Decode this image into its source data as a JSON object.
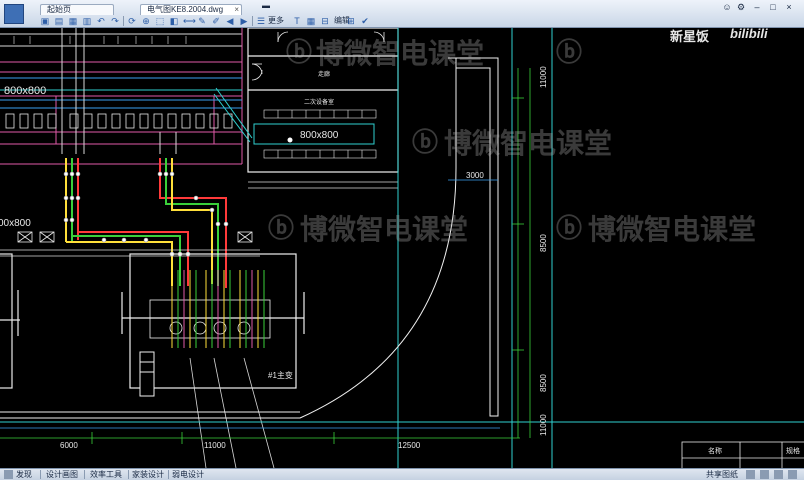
{
  "app": {
    "tabs": [
      {
        "label": "起始页"
      },
      {
        "label": "电气图KE8.2004.dwg"
      }
    ],
    "toolbar": {
      "more_label": "更多",
      "edit_label": "编辑"
    },
    "window": {
      "login_icon": "user-icon",
      "settings_icon": "gear-icon",
      "minimize": "–",
      "maximize": "□",
      "close": "×"
    }
  },
  "watermark": {
    "brand_text": "新星饭",
    "logo_text": "bilibili",
    "text": "博微智电课堂"
  },
  "drawing": {
    "labels": {
      "size_top_left": "800x800",
      "size_mid": "800x800",
      "size_left_bottom": "00x800",
      "corridor": "走廊",
      "room": "二次设备室",
      "transformer": "#1主变",
      "dim_3000": "3000",
      "dim_6000": "6000",
      "dim_11000": "11000",
      "dim_12500": "12500",
      "dim_r11000": "11000",
      "dim_r8500a": "8500",
      "dim_r8500b": "8500",
      "dim_r11000b": "11000",
      "table_col1": "名称",
      "table_col2": "规格"
    }
  },
  "bottom": {
    "tabs": [
      {
        "label": "发现"
      },
      {
        "label": "设计画图"
      },
      {
        "label": "效率工具"
      },
      {
        "label": "家装设计"
      },
      {
        "label": "弱电设计"
      }
    ],
    "right_label": "共享图纸"
  }
}
